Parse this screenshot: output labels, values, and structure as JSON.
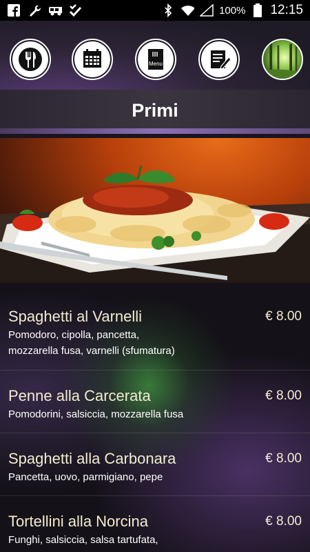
{
  "status_bar": {
    "battery": "100%",
    "time": "12:15",
    "icons": [
      "facebook-icon",
      "wrench-icon",
      "car-icon",
      "checklist-icon",
      "bluetooth-icon",
      "wifi-icon",
      "signal-icon",
      "battery-icon"
    ]
  },
  "nav": {
    "items": [
      {
        "name": "restaurant",
        "icon": "fork-knife-icon"
      },
      {
        "name": "calendar",
        "icon": "calendar-icon"
      },
      {
        "name": "menu",
        "icon": "menu-book-icon",
        "label": "Menu"
      },
      {
        "name": "notes",
        "icon": "notepad-pencil-icon"
      },
      {
        "name": "gallery",
        "icon": "forest-photo-icon"
      }
    ]
  },
  "page": {
    "title": "Primi"
  },
  "colors": {
    "accent": "#8c6fb3",
    "text_cream": "#f3ecd0",
    "background": "#141118"
  },
  "menu": {
    "items": [
      {
        "name": "Spaghetti al Varnelli",
        "price": "€ 8.00",
        "desc_lines": [
          "Pomodoro, cipolla, pancetta,",
          "mozzarella fusa, varnelli (sfumatura)"
        ]
      },
      {
        "name": "Penne alla Carcerata",
        "price": "€ 8.00",
        "desc_lines": [
          "Pomodorini, salsiccia, mozzarella fusa"
        ]
      },
      {
        "name": "Spaghetti alla Carbonara",
        "price": "€ 8.00",
        "desc_lines": [
          "Pancetta, uovo, parmigiano, pepe"
        ]
      },
      {
        "name": "Tortellini alla Norcina",
        "price": "€ 8.00",
        "desc_lines": [
          "Funghi, salsiccia, salsa tartufata,"
        ]
      }
    ]
  }
}
